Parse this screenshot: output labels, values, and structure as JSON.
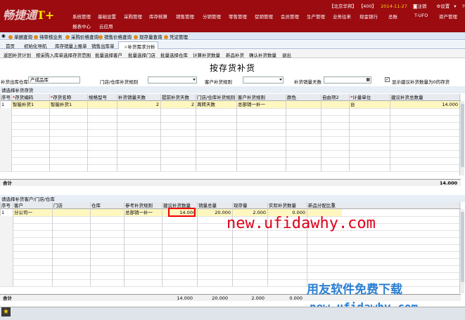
{
  "app": {
    "logo_text": "畅捷通",
    "logo_accent": "T+"
  },
  "menu_row1": [
    "系统管理",
    "基础设置",
    "采购管理",
    "库存核算",
    "销售管理",
    "分销管理",
    "零售管理",
    "促销管理",
    "会员管理",
    "生产管理",
    "业务往来",
    "现金银行",
    "总账",
    "T-UFO",
    "资产管理"
  ],
  "menu_row2": [
    "报表中心",
    "云应用"
  ],
  "sysinfo": {
    "company": "【北京华邦】",
    "code": "【400】",
    "date": "2014-11-27",
    "logout": "注销",
    "settings": "设置",
    "help": "帮助"
  },
  "quick_links": [
    "单据查询",
    "待审核业务",
    "采购价格查询",
    "销售价格查询",
    "现存量查询",
    "凭证管理"
  ],
  "tabs": [
    "首页",
    "初始化导航",
    "库存销量上报单",
    "销售出库单",
    "补货需求分析"
  ],
  "toolbar": [
    "返回补货计划",
    "按采购入库单选择存货范围",
    "批量选择客户",
    "批量选择门店",
    "批量选择仓库",
    "计算补货数量",
    "新品补货",
    "确认补货数量",
    "退出"
  ],
  "title": "按存货补货",
  "filters": {
    "warehouse_label": "补货出库仓库",
    "warehouse_value": "产成品库",
    "store_rule_label": "门店/仓库补货规则",
    "store_rule_value": "",
    "customer_rule_label": "客户补货规则",
    "customer_rule_value": "",
    "sales_days_label": "补货销量天数",
    "sales_days_value": "",
    "show_checkbox_label": "显示建议补货数量为0的存货",
    "show_checked": true
  },
  "grid1": {
    "section_label": "请选择补货存货",
    "headers": [
      "序号",
      "存货编码",
      "存货名称",
      "规格型号",
      "补货销量天数",
      "提前补货天数",
      "门店/仓库补货规则",
      "客户补货规则",
      "颜色",
      "自由项2",
      "计量单位",
      "建议补货总数量"
    ],
    "required_cols": [
      1,
      2,
      10
    ],
    "rows": [
      [
        "1",
        "智能补货1",
        "智能补货1",
        "",
        "2",
        "2",
        "周转天数",
        "总部销一补一",
        "",
        "",
        "台",
        "14.000"
      ]
    ],
    "total_label": "合计",
    "total_value": "14.000"
  },
  "grid2": {
    "section_label": "请选择补货客户/门店/仓库",
    "headers": [
      "序号",
      "客户",
      "门店",
      "仓库",
      "参考补货规则",
      "建议补货数量",
      "销量总量",
      "现存量",
      "实际补货数量",
      "新品分配比重"
    ],
    "rows": [
      [
        "1",
        "分公司一",
        "",
        "",
        "总部销一补一",
        "14.000",
        "20.000",
        "2.000",
        "0.000",
        ""
      ]
    ],
    "total_label": "合计",
    "totals": [
      "14.000",
      "20.000",
      "2.000",
      "0.000"
    ]
  },
  "watermarks": {
    "url_red": "new.ufidawhy.com",
    "brand_blue": "用友软件免费下载",
    "url_blue": "new.ufidawhy.com"
  },
  "colors": {
    "topbar": "#9b0b10",
    "accent": "#ffe400",
    "highlight_row": "#fff7c0",
    "watermark_red": "#e0001a",
    "watermark_blue": "#2a7fd3"
  }
}
